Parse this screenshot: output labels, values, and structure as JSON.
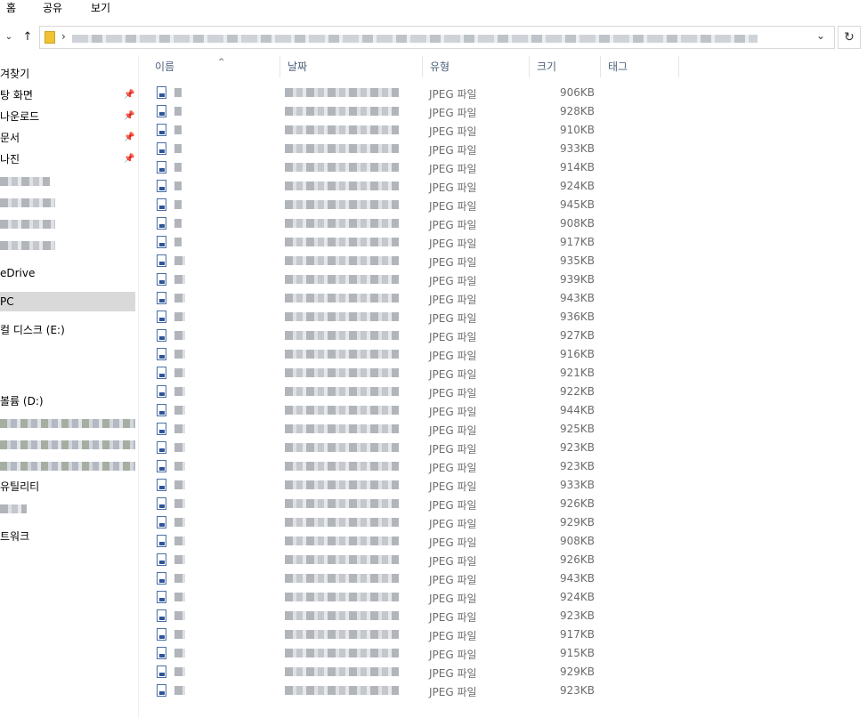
{
  "ribbon": {
    "tabs": [
      "홈",
      "공유",
      "보기"
    ]
  },
  "nav": {
    "up_glyph": "↑",
    "path_separator": "›",
    "dropdown_glyph": "⌄",
    "refresh_glyph": "↻"
  },
  "sidebar": {
    "items": [
      {
        "label": "겨찾기",
        "pinned": false
      },
      {
        "label": "탕 화면",
        "pinned": true
      },
      {
        "label": "나운로드",
        "pinned": true
      },
      {
        "label": "문서",
        "pinned": true
      },
      {
        "label": "나진",
        "pinned": true
      },
      {
        "label": "",
        "pinned": false,
        "blurred": true
      },
      {
        "label": "",
        "pinned": false,
        "blurred": true
      },
      {
        "label": "",
        "pinned": false,
        "blurred": true
      },
      {
        "label": "",
        "pinned": false,
        "blurred": true
      },
      {
        "label": "eDrive",
        "pinned": false
      },
      {
        "label": "PC",
        "pinned": false,
        "selected": true
      },
      {
        "label": "컬 디스크 (E:)",
        "pinned": false
      },
      {
        "label": "볼륨 (D:)",
        "pinned": false
      },
      {
        "label": "",
        "pinned": false,
        "blurred": true
      },
      {
        "label": "",
        "pinned": false,
        "blurred": true
      },
      {
        "label": "",
        "pinned": false,
        "blurred": true
      },
      {
        "label": "유틸리티",
        "pinned": false
      },
      {
        "label": "",
        "pinned": false,
        "blurred": true
      },
      {
        "label": "트워크",
        "pinned": false
      }
    ],
    "pin_glyph": "📌"
  },
  "table": {
    "columns": {
      "name": "이름",
      "date": "날짜",
      "type": "유형",
      "size": "크기",
      "tags": "태그"
    },
    "sort_glyph": "^",
    "file_type": "JPEG 파일",
    "sizes": [
      "906KB",
      "928KB",
      "910KB",
      "933KB",
      "914KB",
      "924KB",
      "945KB",
      "908KB",
      "917KB",
      "935KB",
      "939KB",
      "943KB",
      "936KB",
      "927KB",
      "916KB",
      "921KB",
      "922KB",
      "944KB",
      "925KB",
      "923KB",
      "923KB",
      "933KB",
      "926KB",
      "929KB",
      "908KB",
      "926KB",
      "943KB",
      "924KB",
      "923KB",
      "917KB",
      "915KB",
      "929KB",
      "923KB"
    ]
  }
}
